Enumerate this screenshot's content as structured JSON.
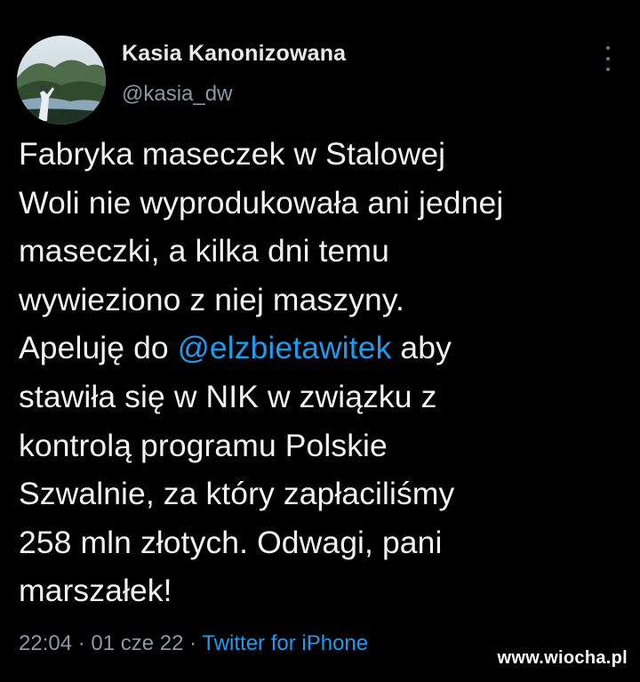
{
  "author": {
    "display_name": "Kasia Kanonizowana",
    "handle": "@kasia_dw",
    "avatar_icon": "landscape-avatar"
  },
  "tweet": {
    "lines": [
      {
        "before": "Fabryka maseczek w Stalowej"
      },
      {
        "before": "Woli nie wyprodukowała ani jednej"
      },
      {
        "before": "maseczki, a kilka dni temu"
      },
      {
        "before": "wywieziono z niej maszyny."
      },
      {
        "before": "Apeluję do ",
        "mention": "@elzbietawitek",
        "after": " aby"
      },
      {
        "before": "stawiła się w NIK w związku z"
      },
      {
        "before": "kontrolą programu Polskie"
      },
      {
        "before": "Szwalnie, za który zapłaciliśmy"
      },
      {
        "before": "258 mln złotych. Odwagi, pani"
      },
      {
        "before": "marszałek!"
      }
    ]
  },
  "meta": {
    "time": "22:04",
    "separator": " · ",
    "date": "01 cze 22",
    "source": "Twitter for iPhone"
  },
  "watermark": "www.wiocha.pl",
  "colors": {
    "background": "#000000",
    "link": "#1d9bf0",
    "secondary_text": "#8b98a5"
  }
}
